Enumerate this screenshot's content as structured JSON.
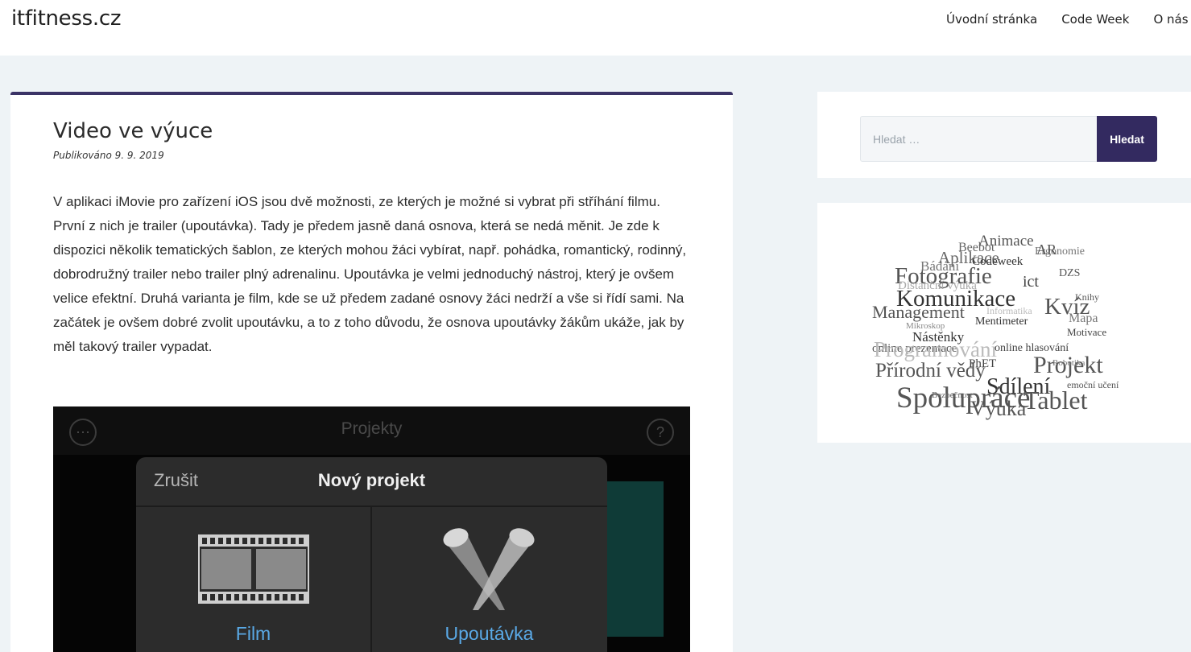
{
  "site": {
    "title": "itfitness.cz"
  },
  "nav": {
    "items": [
      "Úvodní stránka",
      "Code Week",
      "O nás"
    ]
  },
  "article": {
    "title": "Video ve výuce",
    "meta": "Publikováno 9. 9. 2019",
    "body": "V aplikaci iMovie pro zařízení iOS jsou dvě možnosti, ze kterých je možné si vybrat při stříhání filmu. První z nich je trailer (upoutávka). Tady je předem jasně daná osnova, která se nedá měnit. Je zde k dispozici několik tematických šablon, ze kterých mohou žáci vybírat, např. pohádka, romantický, rodinný, dobrodružný trailer nebo trailer plný adrenalinu. Upoutávka je velmi jednoduchý nástroj, který je ovšem velice efektní. Druhá varianta je film, kde se už předem zadané osnovy žáci nedrží a vše si řídí sami. Na začátek je ovšem dobré zvolit upoutávku, a to z toho důvodu, že osnova upoutávky žákům ukáže, jak by měl takový trailer vypadat."
  },
  "screenshot": {
    "header_title": "Projekty",
    "more_icon": "ellipsis-circle-icon",
    "help_icon": "question-circle-icon",
    "modal": {
      "cancel_label": "Zrušit",
      "title": "Nový projekt",
      "options": [
        {
          "label": "Film",
          "icon": "film-strip-icon"
        },
        {
          "label": "Upoutávka",
          "icon": "spotlights-icon"
        }
      ]
    }
  },
  "search": {
    "placeholder": "Hledat …",
    "button_label": "Hledat"
  },
  "tag_cloud": {
    "tags": [
      "Animace",
      "Beebot",
      "Aplikace",
      "Ergonomie",
      "AR",
      "Bádání",
      "Codeweek",
      "Fotografie",
      "ict",
      "DZS",
      "Distanční výuka",
      "Komunikace",
      "Knihy",
      "Kvíz",
      "Management",
      "Mentimeter",
      "Mapa",
      "Mikroskop",
      "Motivace",
      "Nástěnky",
      "online prezentace",
      "online hlasování",
      "Programování",
      "PhET",
      "Přírodní vědy",
      "Projekt",
      "Sdílení",
      "Spolupráce",
      "Tablet",
      "Výuka",
      "emoční učení",
      "Bezpečnost",
      "Robotika",
      "Informatika"
    ]
  },
  "colors": {
    "accent": "#332a60",
    "link": "#5aa9e6",
    "background": "#eef3f6"
  }
}
